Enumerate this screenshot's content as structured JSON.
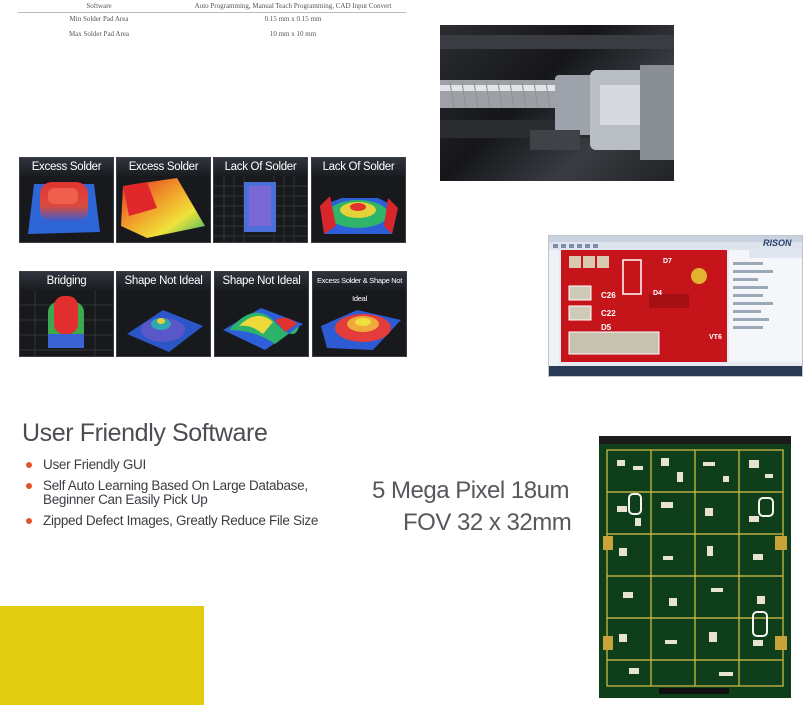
{
  "spec_table": {
    "rows": [
      {
        "label": "Software",
        "value": "Auto Programming, Manual Teach Programming, CAD Input Convert"
      },
      {
        "label": "Min Solder Pad Area",
        "value": "0.15 mm x 0.15 mm"
      },
      {
        "label": "Max Solder Pad Area",
        "value": "10 mm x 10 mm"
      }
    ]
  },
  "defects": [
    {
      "label": "Excess Solder"
    },
    {
      "label": "Excess Solder"
    },
    {
      "label": "Lack Of Solder"
    },
    {
      "label": "Lack Of Solder"
    },
    {
      "label": "Bridging"
    },
    {
      "label": "Shape Not Ideal"
    },
    {
      "label": "Shape Not Ideal"
    },
    {
      "label": "Excess Solder & Shape Not Ideal"
    }
  ],
  "software_screenshot": {
    "brand": "RISON",
    "pcb_labels": [
      "C26",
      "C22",
      "D5",
      "D7",
      "D4",
      "VT6"
    ]
  },
  "section": {
    "title": "User Friendly Software",
    "bullets": [
      "User Friendly GUI",
      "Self Auto Learning Based On Large Database, Beginner Can Easily Pick Up",
      "Zipped Defect Images, Greatly Reduce File Size"
    ],
    "bullet_color": "#e2542a"
  },
  "camera": {
    "line1": "5 Mega Pixel 18um",
    "line2": "FOV 32 x 32mm"
  },
  "accent_color": "#e3cd10"
}
